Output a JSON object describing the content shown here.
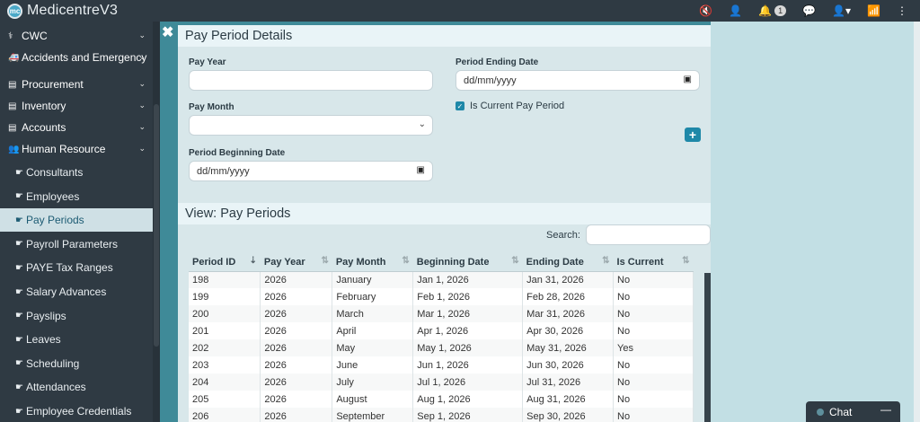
{
  "app": {
    "name": "MedicentreV3",
    "logo_text": "mc"
  },
  "topbar": {
    "icons": [
      {
        "name": "mute-icon",
        "glyph": "🔇"
      },
      {
        "name": "support-icon",
        "glyph": "👤"
      },
      {
        "name": "bell-icon",
        "glyph": "🔔",
        "badge": "1"
      },
      {
        "name": "chat-bubbles-icon",
        "glyph": "💬"
      },
      {
        "name": "user-menu-icon",
        "glyph": "👤▾"
      },
      {
        "name": "wifi-icon",
        "glyph": "📶"
      },
      {
        "name": "kebab-menu-icon",
        "glyph": "⋮"
      }
    ]
  },
  "sidebar": {
    "sections": [
      {
        "label": "CWC",
        "icon": "stethoscope-icon",
        "glyph": "⚕"
      },
      {
        "label": "Accidents and Emergency",
        "icon": "ambulance-icon",
        "glyph": "🚑"
      },
      {
        "label": "Procurement",
        "icon": "clipboard-icon",
        "glyph": "▤"
      },
      {
        "label": "Inventory",
        "icon": "box-icon",
        "glyph": "▤"
      },
      {
        "label": "Accounts",
        "icon": "ledger-icon",
        "glyph": "▤"
      },
      {
        "label": "Human Resource",
        "icon": "users-icon",
        "glyph": "👥"
      }
    ],
    "items": [
      {
        "label": "Consultants"
      },
      {
        "label": "Employees"
      },
      {
        "label": "Pay Periods"
      },
      {
        "label": "Payroll Parameters"
      },
      {
        "label": "PAYE Tax Ranges"
      },
      {
        "label": "Salary Advances"
      },
      {
        "label": "Payslips"
      },
      {
        "label": "Leaves"
      },
      {
        "label": "Scheduling"
      },
      {
        "label": "Attendances"
      },
      {
        "label": "Employee Credentials"
      }
    ],
    "active_item": "Pay Periods"
  },
  "modal": {
    "close_glyph": "✖",
    "title": "Pay Period Details",
    "form": {
      "pay_year_label": "Pay Year",
      "pay_year_value": "",
      "pay_month_label": "Pay Month",
      "pay_month_value": "",
      "period_beginning_label": "Period Beginning Date",
      "period_beginning_value": "dd/mm/yyyy",
      "period_ending_label": "Period Ending Date",
      "period_ending_value": "dd/mm/yyyy",
      "is_current_label": "Is Current Pay Period",
      "is_current_checked": true,
      "add_button_glyph": "+"
    },
    "view_title": "View: Pay Periods",
    "search_label": "Search:",
    "search_value": "",
    "table": {
      "headers": [
        "Period ID",
        "Pay Year",
        "Pay Month",
        "Beginning Date",
        "Ending Date",
        "Is Current"
      ],
      "rows": [
        [
          "198",
          "2026",
          "January",
          "Jan 1, 2026",
          "Jan 31, 2026",
          "No"
        ],
        [
          "199",
          "2026",
          "February",
          "Feb 1, 2026",
          "Feb 28, 2026",
          "No"
        ],
        [
          "200",
          "2026",
          "March",
          "Mar 1, 2026",
          "Mar 31, 2026",
          "No"
        ],
        [
          "201",
          "2026",
          "April",
          "Apr 1, 2026",
          "Apr 30, 2026",
          "No"
        ],
        [
          "202",
          "2026",
          "May",
          "May 1, 2026",
          "May 31, 2026",
          "Yes"
        ],
        [
          "203",
          "2026",
          "June",
          "Jun 1, 2026",
          "Jun 30, 2026",
          "No"
        ],
        [
          "204",
          "2026",
          "July",
          "Jul 1, 2026",
          "Jul 31, 2026",
          "No"
        ],
        [
          "205",
          "2026",
          "August",
          "Aug 1, 2026",
          "Aug 31, 2026",
          "No"
        ],
        [
          "206",
          "2026",
          "September",
          "Sep 1, 2026",
          "Sep 30, 2026",
          "No"
        ]
      ]
    }
  },
  "chat_widget": {
    "label": "Chat",
    "minimize_glyph": "—"
  },
  "colors": {
    "accent": "#1e88a8",
    "sidebar_bg": "#2f3a43",
    "active_item_bg": "#cfe0e5"
  }
}
